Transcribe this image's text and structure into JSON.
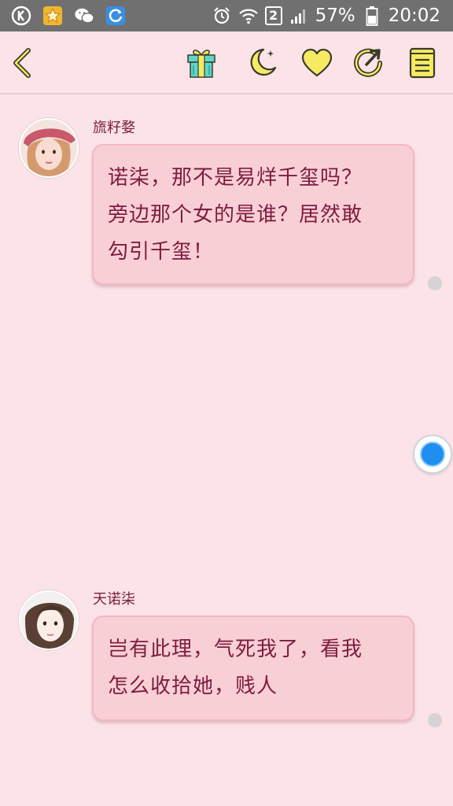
{
  "status_bar": {
    "battery": "57%",
    "time": "20:02",
    "sim_badge": "2",
    "left_icons": [
      "k-app-icon",
      "star-app-icon",
      "wechat-icon",
      "browser-icon"
    ],
    "right_icons": [
      "alarm-icon",
      "wifi-icon",
      "sim-icon",
      "signal-icon",
      "battery-icon"
    ]
  },
  "toolbar": {
    "icons": [
      "back-icon",
      "gift-icon",
      "night-mode-icon",
      "favorite-icon",
      "share-icon",
      "catalog-icon"
    ],
    "accent": "#f6ea63",
    "stroke": "#3a3a2a"
  },
  "messages": [
    {
      "sender": "旒籽婺",
      "text_lines": [
        "诺柒，那不是易烊千玺吗？",
        "旁边那个女的是谁？居然敢",
        "勾引千玺！"
      ]
    },
    {
      "sender": "天诺柒",
      "text_lines": [
        "岂有此理，气死我了，看我",
        "怎么收拾她，贱人"
      ]
    }
  ],
  "colors": {
    "background": "#fbe3e8",
    "bubble": "#f9cfd6",
    "bubble_text": "#7d1c3e",
    "sender_text": "#7a1f3a",
    "status_bar": "#707070",
    "float_button": "#1e8ef0"
  }
}
